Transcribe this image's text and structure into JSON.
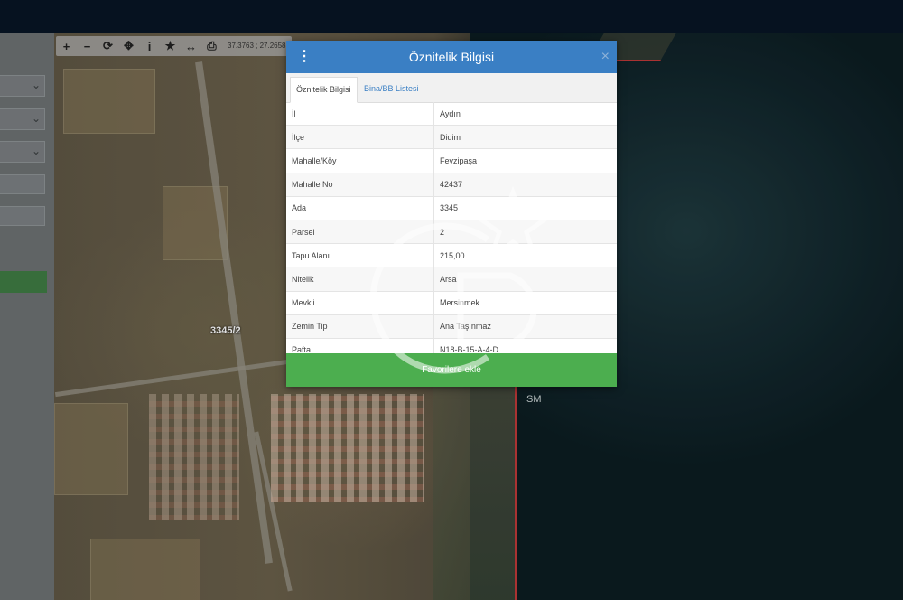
{
  "map": {
    "parcel_label": "3345/2",
    "sm_label": "SM"
  },
  "toolbar": {
    "coords": "37.3763 ; 27.2658",
    "buttons": [
      "zoom-in",
      "zoom-out",
      "refresh",
      "locate",
      "info",
      "favorite",
      "measure",
      "print"
    ]
  },
  "dialog": {
    "title": "Öznitelik Bilgisi",
    "tabs": [
      "Öznitelik Bilgisi",
      "Bina/BB Listesi"
    ],
    "rows": [
      {
        "label": "İl",
        "value": "Aydın"
      },
      {
        "label": "İlçe",
        "value": "Didim"
      },
      {
        "label": "Mahalle/Köy",
        "value": "Fevzipaşa"
      },
      {
        "label": "Mahalle No",
        "value": "42437"
      },
      {
        "label": "Ada",
        "value": "3345"
      },
      {
        "label": "Parsel",
        "value": "2"
      },
      {
        "label": "Tapu Alanı",
        "value": "215,00"
      },
      {
        "label": "Nitelik",
        "value": "Arsa"
      },
      {
        "label": "Mevkii",
        "value": "Mersinmek"
      },
      {
        "label": "Zemin Tip",
        "value": "Ana Taşınmaz"
      },
      {
        "label": "Pafta",
        "value": "N18-B-15-A-4-D"
      }
    ],
    "favorite_button": "Favorilere ekle"
  },
  "colors": {
    "header": "#3a7fc4",
    "favorite": "#4cae4f",
    "boundary": "#c23a3a"
  }
}
